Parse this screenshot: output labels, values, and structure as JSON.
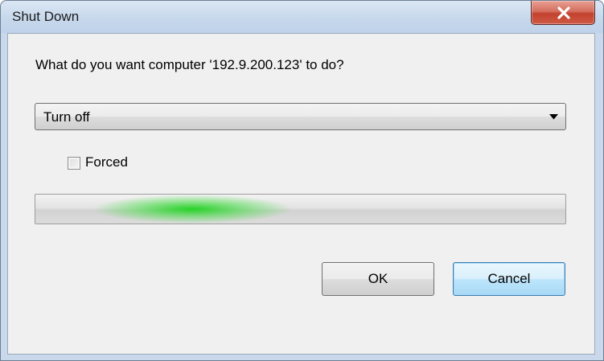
{
  "window": {
    "title": "Shut Down",
    "close_icon": "close-icon"
  },
  "dialog": {
    "prompt": "What do you want computer  '192.9.200.123' to do?",
    "action_select": {
      "selected": "Turn off",
      "arrow_icon": "dropdown-arrow-icon"
    },
    "forced_checkbox": {
      "label": "Forced",
      "checked": false
    },
    "progress": {
      "style": "marquee"
    },
    "buttons": {
      "ok": "OK",
      "cancel": "Cancel"
    }
  },
  "colors": {
    "close_button": "#c2412f",
    "progress_glow": "#1ed21e",
    "default_button_border": "#3c7fb1"
  }
}
